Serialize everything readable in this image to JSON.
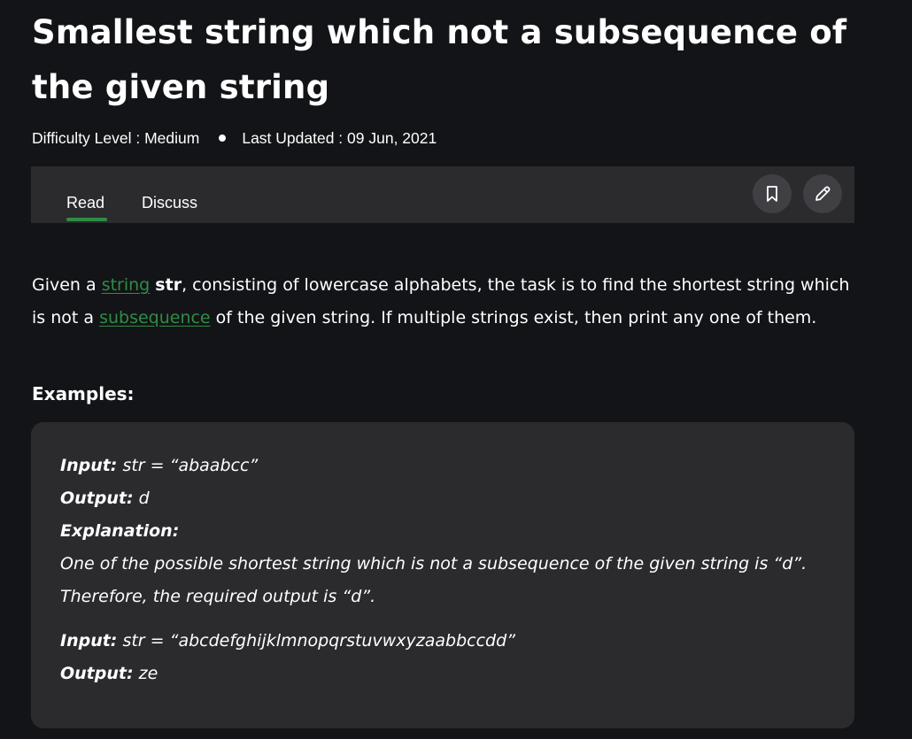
{
  "article": {
    "title": "Smallest string which not a subsequence of the given string",
    "difficulty": "Difficulty Level : Medium",
    "last_updated": "Last Updated : 09 Jun, 2021"
  },
  "tabs": {
    "read": "Read",
    "discuss": "Discuss",
    "active": "Read",
    "accent_color": "#2f8d46"
  },
  "actions": {
    "bookmark_icon": "bookmark-icon",
    "edit_icon": "pencil-icon"
  },
  "content": {
    "intro_1": "Given a ",
    "link_string": "string",
    "intro_2": " ",
    "str_bold": "str",
    "intro_3": ", consisting of lowercase alphabets, the task is to find the shortest string which is not a ",
    "link_subsequence": "subsequence",
    "intro_4": " of the given string. If multiple strings exist, then print any one of them.",
    "examples_heading": "Examples:"
  },
  "examples": {
    "input_label": "Input:",
    "output_label": "Output:",
    "explanation_label": "Explanation:",
    "ex1_input": " str = “abaabcc”",
    "ex1_output": " d",
    "ex1_explanation_1": "One of the possible shortest string which is not a subsequence of the given string is “d”.",
    "ex1_explanation_2": "Therefore, the required output is “d”.",
    "ex2_input": " str = “abcdefghijklmnopqrstuvwxyzaabbccdd”",
    "ex2_output": " ze"
  }
}
